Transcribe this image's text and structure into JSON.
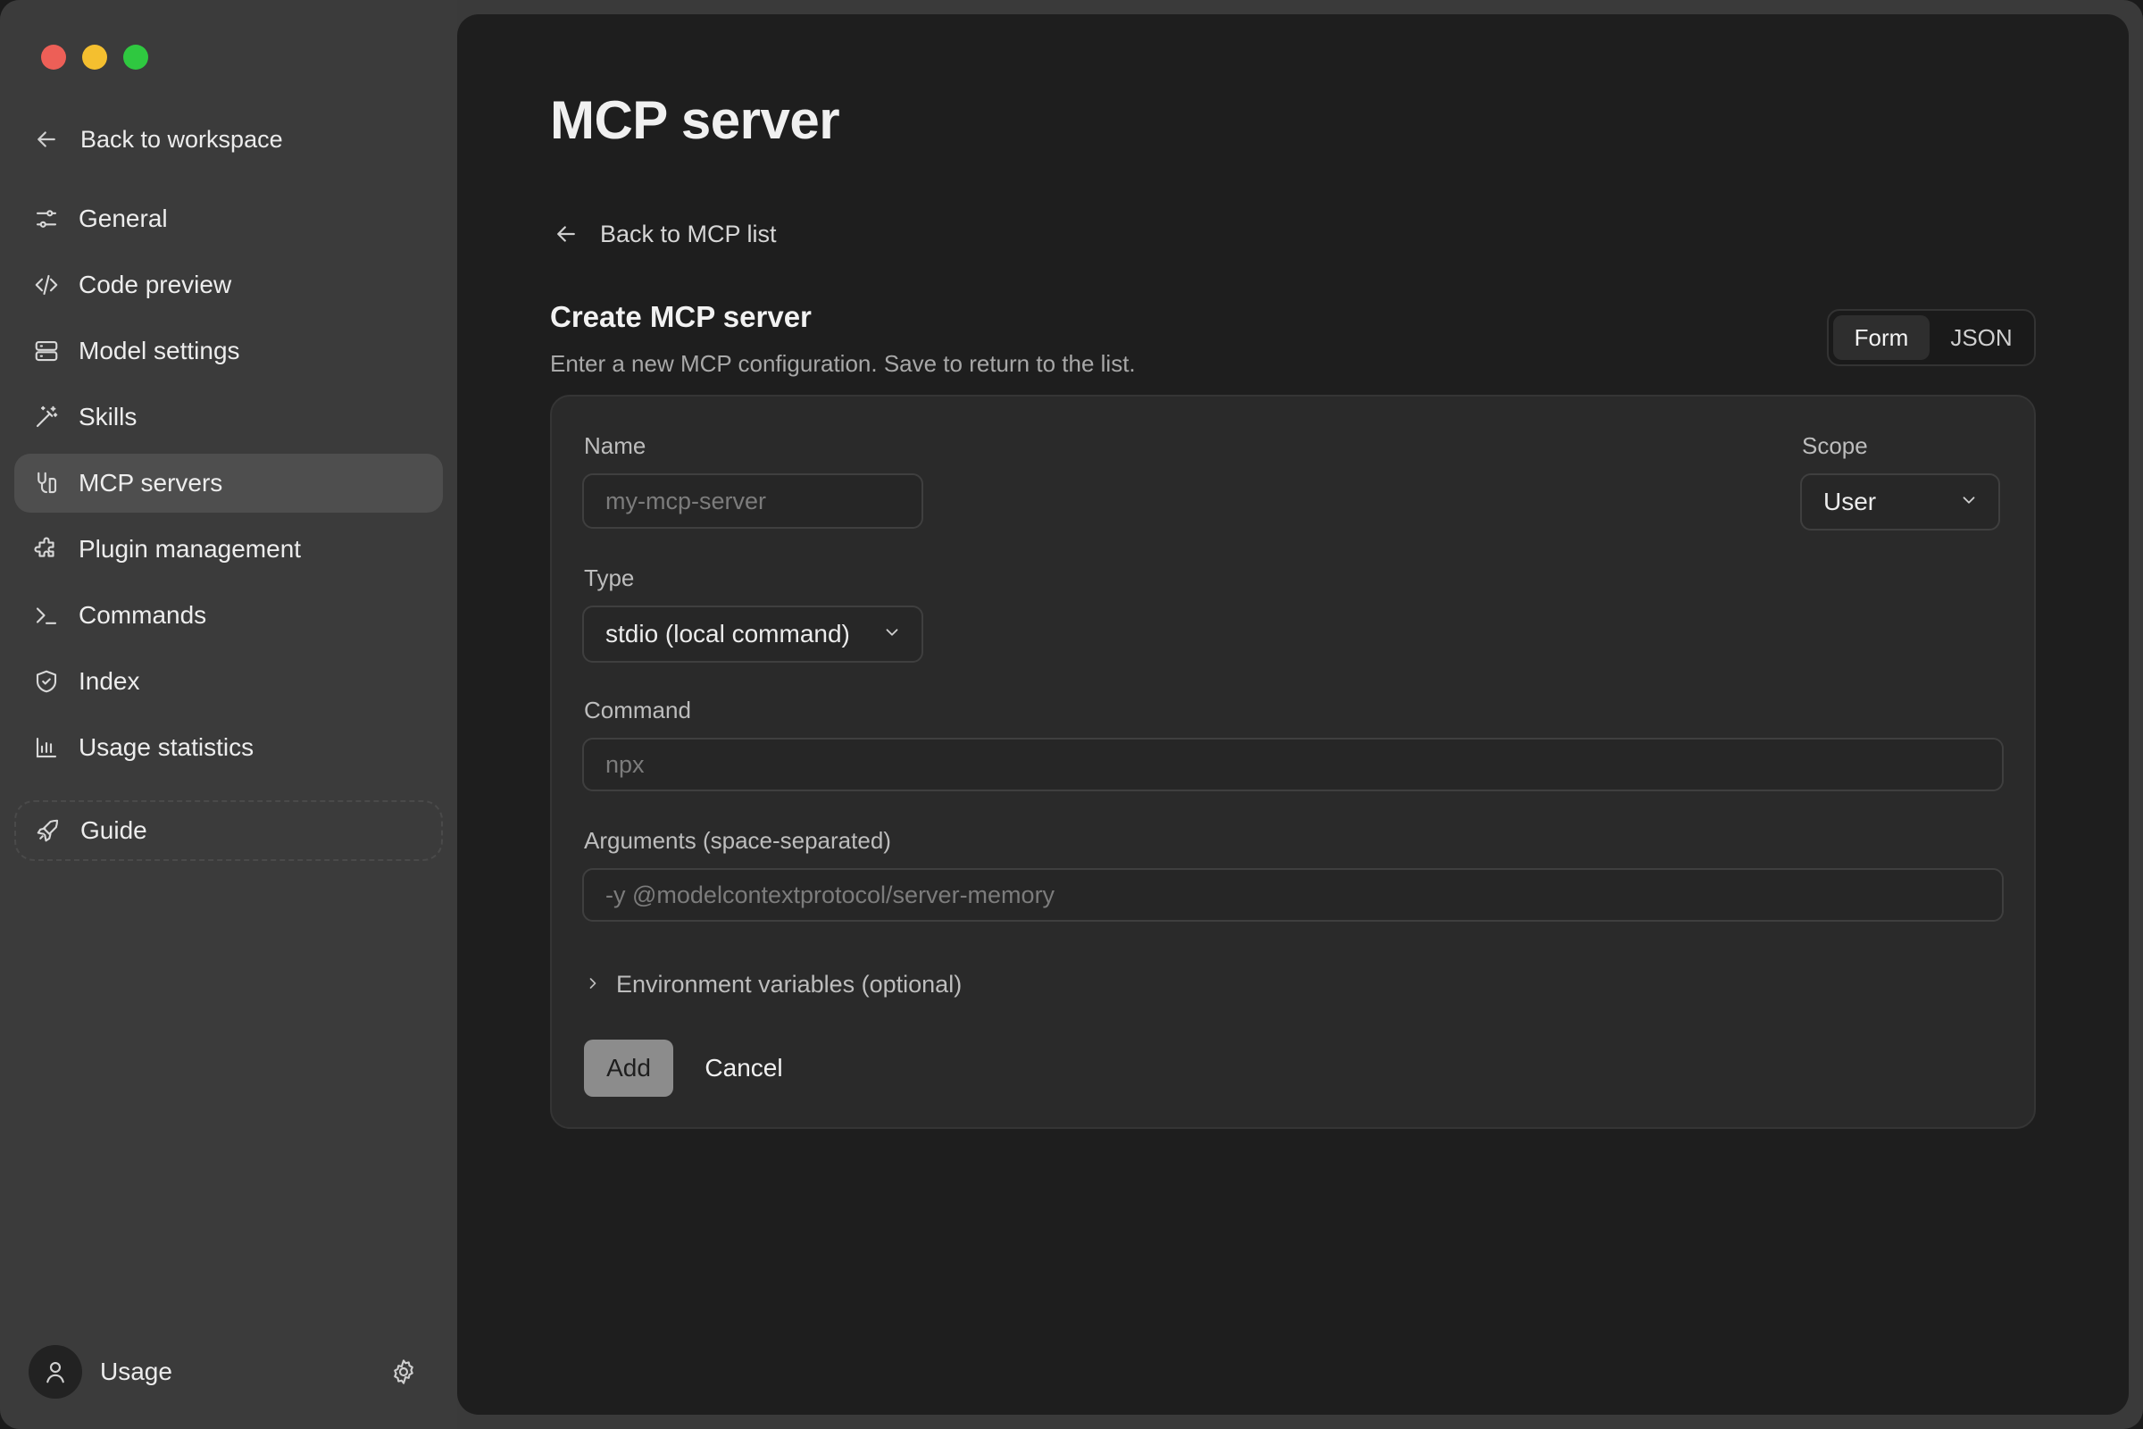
{
  "window": {
    "traffic_lights": {
      "close": "#ed5f57",
      "minimize": "#f4bf2f",
      "maximize": "#2fc840"
    }
  },
  "sidebar": {
    "back_label": "Back to workspace",
    "items": [
      {
        "id": "general",
        "label": "General",
        "icon": "sliders-icon"
      },
      {
        "id": "code-preview",
        "label": "Code preview",
        "icon": "code-icon"
      },
      {
        "id": "model-settings",
        "label": "Model settings",
        "icon": "server-stack-icon"
      },
      {
        "id": "skills",
        "label": "Skills",
        "icon": "magic-wand-icon"
      },
      {
        "id": "mcp-servers",
        "label": "MCP servers",
        "icon": "plug-icon",
        "active": true
      },
      {
        "id": "plugin-management",
        "label": "Plugin management",
        "icon": "puzzle-icon"
      },
      {
        "id": "commands",
        "label": "Commands",
        "icon": "terminal-icon"
      },
      {
        "id": "index",
        "label": "Index",
        "icon": "shield-check-icon"
      },
      {
        "id": "usage-statistics",
        "label": "Usage statistics",
        "icon": "bar-chart-icon"
      }
    ],
    "guide_label": "Guide",
    "user": {
      "label": "Usage"
    }
  },
  "main": {
    "title": "MCP server",
    "back_link": "Back to MCP list",
    "section_title": "Create MCP server",
    "section_desc": "Enter a new MCP configuration. Save to return to the list.",
    "view_toggle": {
      "options": [
        "Form",
        "JSON"
      ],
      "selected": "Form"
    },
    "form": {
      "name_label": "Name",
      "name_placeholder": "my-mcp-server",
      "scope_label": "Scope",
      "scope_value": "User",
      "type_label": "Type",
      "type_value": "stdio (local command)",
      "command_label": "Command",
      "command_placeholder": "npx",
      "args_label": "Arguments (space-separated)",
      "args_placeholder": "-y @modelcontextprotocol/server-memory",
      "env_label": "Environment variables (optional)",
      "add_label": "Add",
      "cancel_label": "Cancel"
    }
  }
}
